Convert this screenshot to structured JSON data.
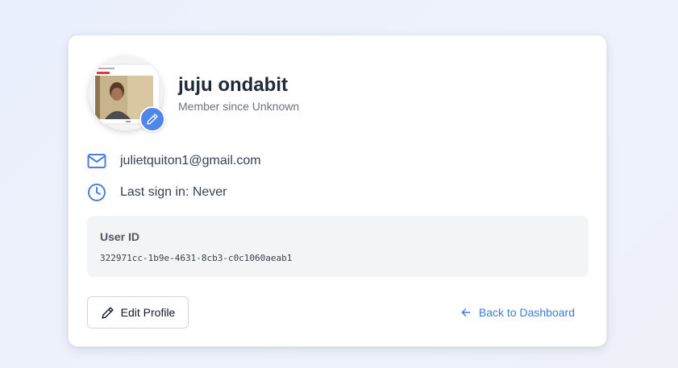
{
  "profile": {
    "name": "juju ondabit",
    "member_since": "Member since Unknown"
  },
  "info": {
    "email": "julietquiton1@gmail.com",
    "last_sign_in": "Last sign in: Never"
  },
  "user_id": {
    "label": "User ID",
    "value": "322971cc-1b9e-4631-8cb3-c0c1060aeab1"
  },
  "actions": {
    "edit_profile": "Edit Profile",
    "back": "Back to Dashboard"
  },
  "colors": {
    "accent": "#4f86e8",
    "link": "#3b7be0",
    "icon_blue": "#4a7fdc"
  },
  "icons": {
    "avatar_edit": "pencil-icon",
    "email": "mail-icon",
    "last_sign_in": "clock-icon",
    "edit_profile": "pencil-icon",
    "back": "arrow-left-icon"
  }
}
